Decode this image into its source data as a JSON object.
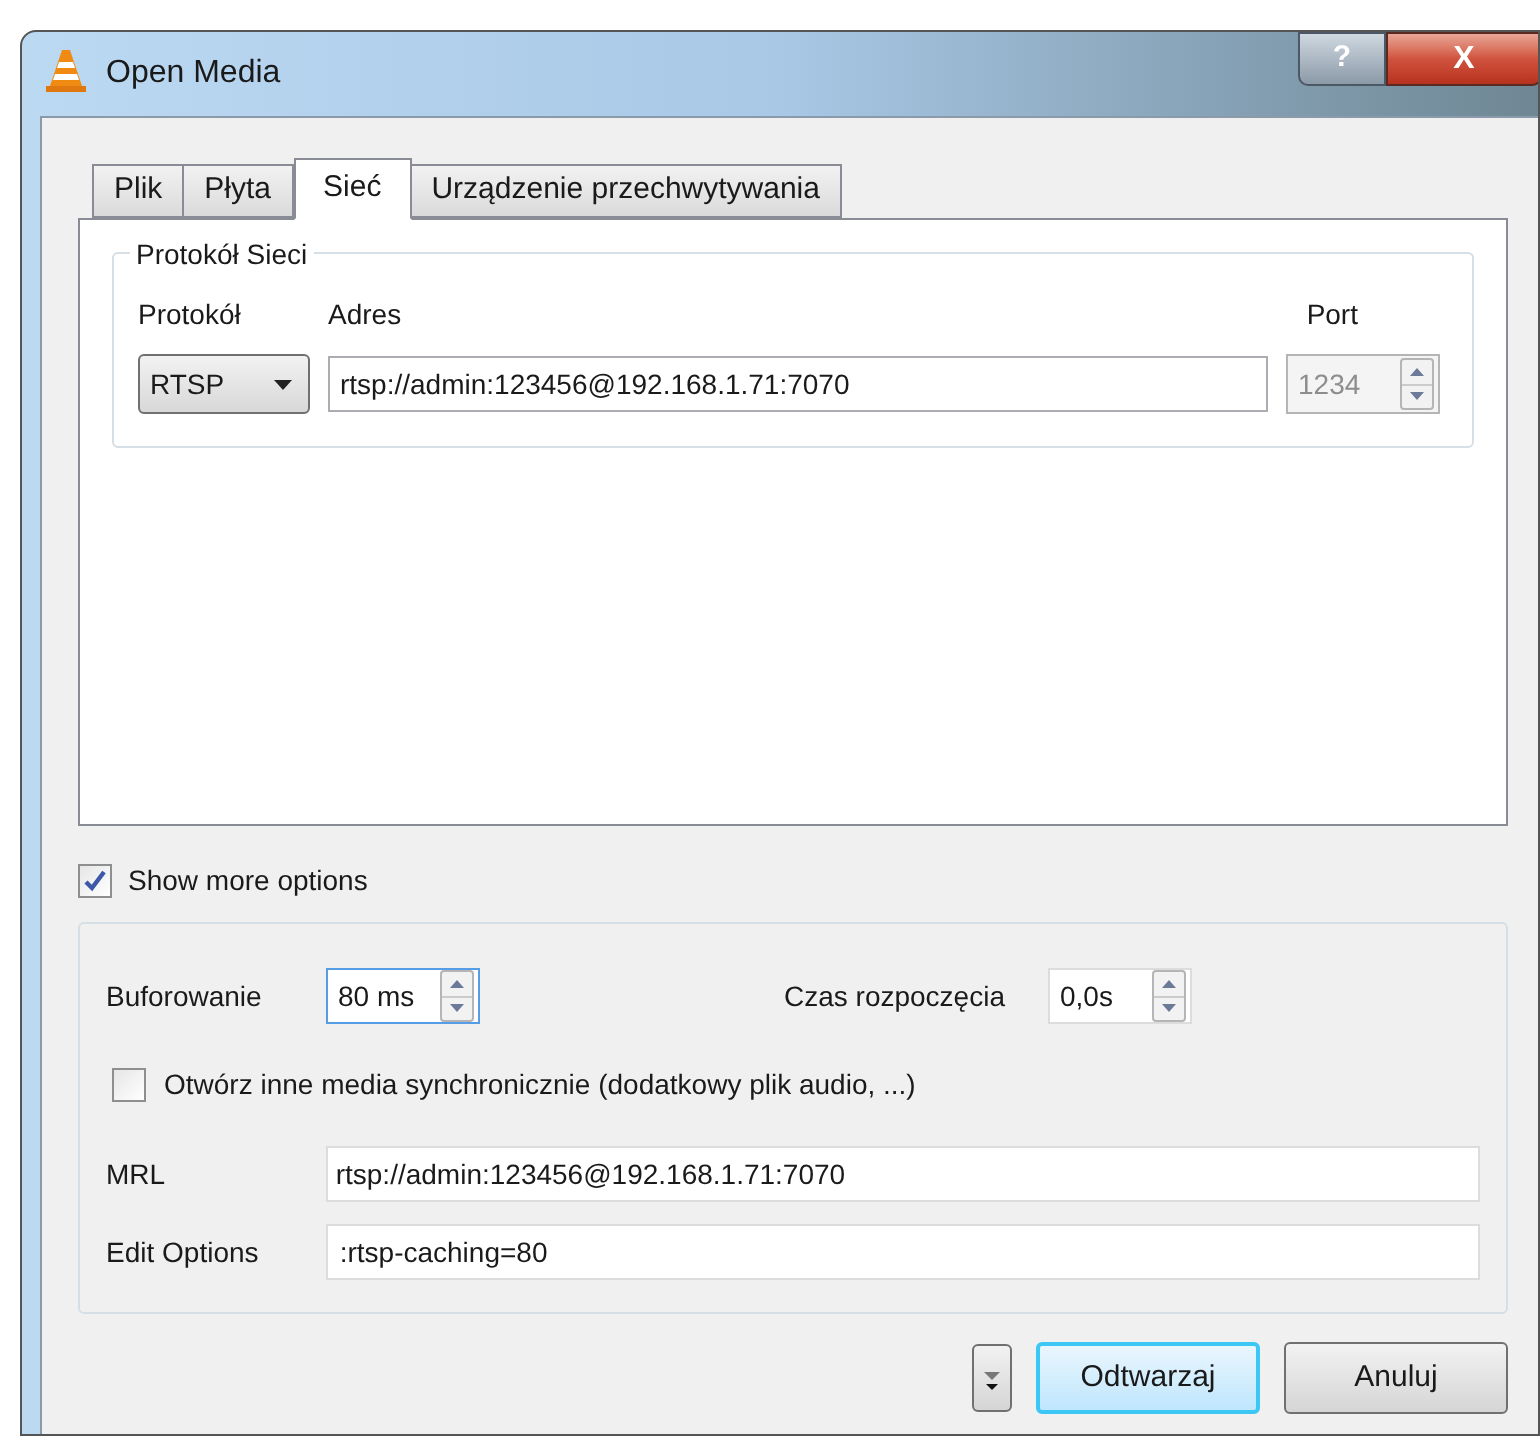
{
  "window": {
    "title": "Open Media"
  },
  "title_buttons": [
    {
      "kind": "help",
      "label": "?"
    },
    {
      "kind": "close",
      "label": "X"
    }
  ],
  "tabs": [
    {
      "label": "Plik",
      "selected": false
    },
    {
      "label": "Płyta",
      "selected": false
    },
    {
      "label": "Sieć",
      "selected": true
    },
    {
      "label": "Urządzenie przechwytywania",
      "selected": false
    }
  ],
  "network_group": {
    "title": "Protokół Sieci",
    "protocol_label": "Protokół",
    "protocol": "RTSP",
    "address_label": "Adres",
    "address": "rtsp://admin:123456@192.168.1.71:7070",
    "port_label": "Port",
    "port": "1234",
    "port_disabled": true
  },
  "show_more_options": {
    "label": "Show more options",
    "checked": true
  },
  "options": {
    "caching_label": "Buforowanie",
    "caching": "80 ms",
    "start_label": "Czas rozpoczęcia",
    "start": "0,0s",
    "sync": {
      "label": "Otwórz inne media synchronicznie (dodatkowy plik audio, ...)",
      "checked": false
    },
    "mrl_label": "MRL",
    "mrl": "rtsp://admin:123456@192.168.1.71:7070",
    "edit_label": "Edit Options",
    "edit": ":rtsp-caching=80"
  },
  "buttons": [
    {
      "label": "Odtwarzaj",
      "default": true
    },
    {
      "label": "Anuluj",
      "default": false
    }
  ]
}
